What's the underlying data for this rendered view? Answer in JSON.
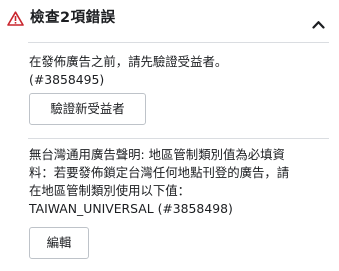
{
  "header": {
    "title": "檢查2項錯誤",
    "warning_icon": "warning-triangle-icon",
    "collapse_icon": "chevron-up-icon",
    "warning_color": "#c9252d"
  },
  "errors": [
    {
      "line1": "在發佈廣告之前，請先驗證受益者。",
      "line2": "(#3858495)",
      "button_label": "驗證新受益者"
    },
    {
      "line1": "無台灣通用廣告聲明: 地區管制類別值為必填資",
      "line2": "料：若要發佈鎖定台灣任何地點刊登的廣告，請",
      "line3": "在地區管制類別使用以下值：",
      "line4": "TAIWAN_UNIVERSAL (#3858498)",
      "button_label": "編輯"
    }
  ]
}
